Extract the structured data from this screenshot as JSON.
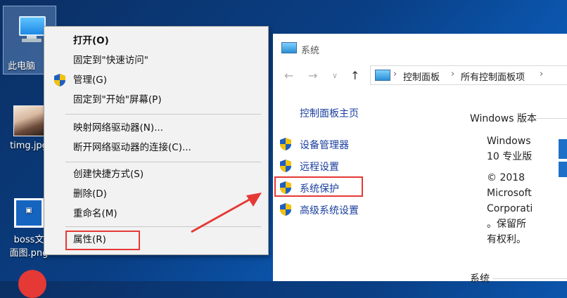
{
  "desktop": {
    "icons": [
      {
        "label": "此电脑"
      },
      {
        "label": "timg.jpg"
      },
      {
        "label_line1": "boss文",
        "label_line2": "面图.png"
      }
    ]
  },
  "context_menu": {
    "items": [
      {
        "label": "打开(O)",
        "bold": true
      },
      {
        "label": "固定到\"快速访问\""
      },
      {
        "label": "管理(G)",
        "icon": "shield-icon"
      },
      {
        "label": "固定到\"开始\"屏幕(P)"
      },
      {
        "label": "映射网络驱动器(N)..."
      },
      {
        "label": "断开网络驱动器的连接(C)..."
      },
      {
        "label": "创建快捷方式(S)"
      },
      {
        "label": "删除(D)"
      },
      {
        "label": "重命名(M)"
      },
      {
        "label": "属性(R)",
        "highlighted": true
      }
    ]
  },
  "system_window": {
    "title": "系统",
    "address": {
      "segments": [
        "控制面板",
        "所有控制面板项"
      ]
    },
    "left_panel": {
      "home": "控制面板主页",
      "links": [
        {
          "label": "设备管理器",
          "icon": "shield-icon"
        },
        {
          "label": "远程设置",
          "icon": "shield-icon"
        },
        {
          "label": "系统保护",
          "icon": "shield-icon",
          "highlighted": true
        },
        {
          "label": "高级系统设置",
          "icon": "shield-icon"
        }
      ]
    },
    "edition_section": {
      "title": "Windows 版本",
      "lines": [
        "Windows",
        "10 专业版",
        "© 2018",
        "Microsoft",
        "Corporati",
        "。保留所",
        "有权利。"
      ]
    },
    "system_section": {
      "title": "系统"
    }
  },
  "colors": {
    "highlight": "#e53935",
    "link": "#1a3e9e",
    "shield_blue": "#1e5fbf",
    "shield_yellow": "#f4c20d"
  }
}
